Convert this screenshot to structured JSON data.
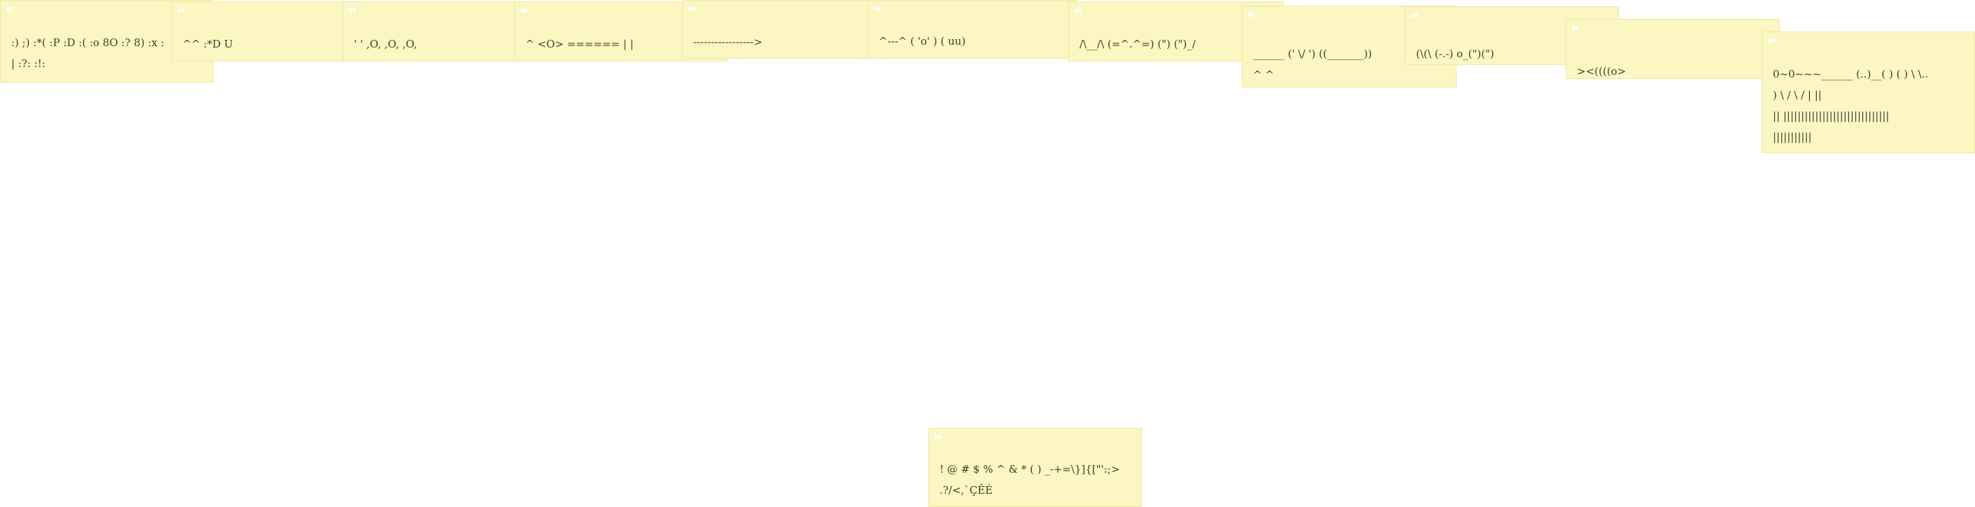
{
  "notes": [
    {
      "id": "note-1",
      "lines": [
        ":) ;) :*( :P :D :( :o 8O :? 8) :x :",
        "| :?: :!:"
      ]
    },
    {
      "id": "note-2",
      "lines": [
        "^^ :*D U"
      ]
    },
    {
      "id": "note-3",
      "lines": [
        "' ' ,O, ,O, ,O,"
      ]
    },
    {
      "id": "note-4",
      "lines": [
        "^ <O> ====== | |"
      ]
    },
    {
      "id": "note-5",
      "lines": [
        "----------------->"
      ]
    },
    {
      "id": "note-6",
      "lines": [
        "^---^ ( 'o' ) ( uu)"
      ]
    },
    {
      "id": "note-7",
      "lines": [
        "/\\__/\\ (=^.^=) (\") (\")_/"
      ]
    },
    {
      "id": "note-8",
      "lines": [
        "______ (' \\/ ') ((_______))",
        "^ ^"
      ]
    },
    {
      "id": "note-9",
      "lines": [
        "(\\(\\ (-.-) o_(\")(\")"
      ]
    },
    {
      "id": "note-10",
      "lines": [
        "><((((o>"
      ]
    },
    {
      "id": "note-11",
      "lines": [
        "0~0~~~______ (..)__( ) ( ) \\ \\..",
        ") \\ / \\ / | ||",
        "|| ||||||||||||||||||||||||||||||",
        "|||||||||||"
      ]
    },
    {
      "id": "note-12",
      "lines": [
        "! @ # $ % ^ & * ( ) _-+=\\}]{[\"':;>",
        ".?/<,`ÇÊÉ"
      ]
    }
  ]
}
